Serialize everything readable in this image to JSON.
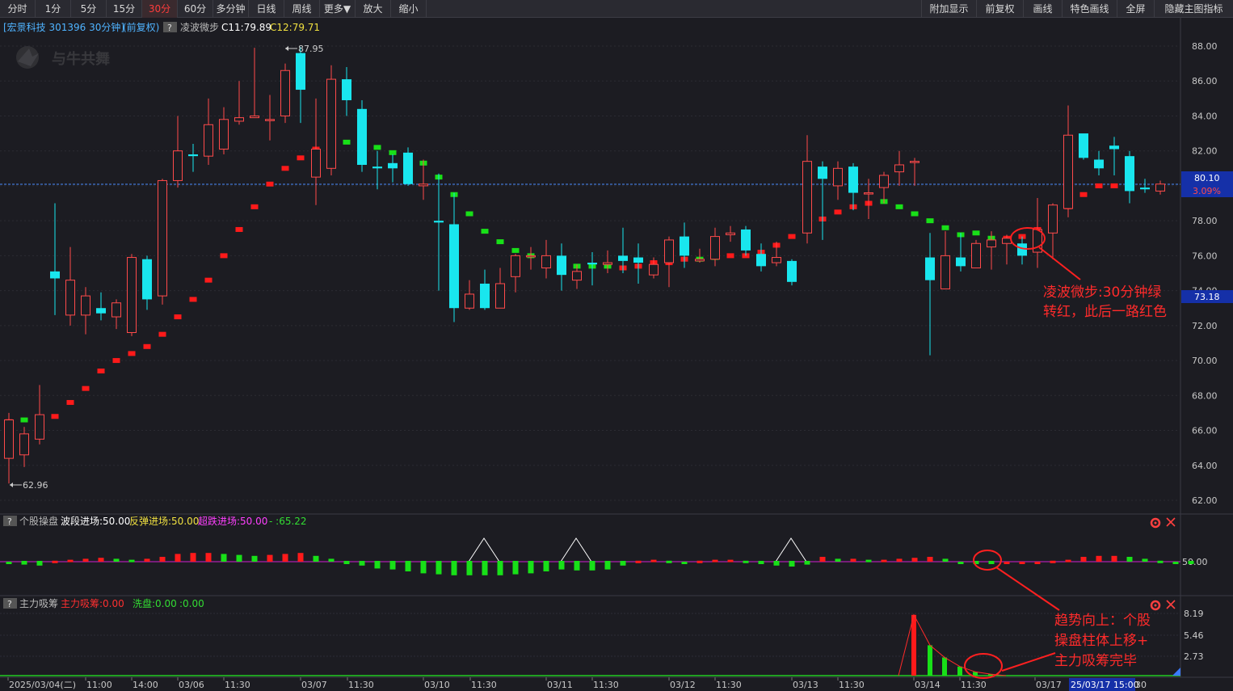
{
  "toolbar": {
    "left": [
      "分时",
      "1分",
      "5分",
      "15分",
      "30分",
      "60分",
      "多分钟",
      "日线",
      "周线",
      "更多▼",
      "放大",
      "缩小"
    ],
    "active": "30分",
    "right": [
      "附加显示",
      "前复权",
      "画线",
      "特色画线",
      "全屏",
      "隐藏主图指标"
    ]
  },
  "main_panel": {
    "stock_label": "[宏景科技 301396 30分钟]",
    "adjust_label": "(前复权)",
    "help_mark": "?",
    "indicator_name": "凌波微步",
    "c1_label": "C11:79.89",
    "c2_label": "C12:79.71",
    "watermark": "与牛共舞",
    "high_marker": "87.95",
    "low_marker": "62.96",
    "current_price_tag": "80.10",
    "current_pct_tag": "3.09%",
    "crosshair_tag": "73.18",
    "price_ticks": [
      "88.00",
      "86.00",
      "84.00",
      "82.00",
      "80.00",
      "78.00",
      "76.00",
      "74.00",
      "72.00",
      "70.00",
      "68.00",
      "66.00",
      "64.00",
      "62.00"
    ],
    "annotation_line1": "凌波微步:30分钟绿",
    "annotation_line2": "转红，此后一路红色"
  },
  "panel2": {
    "help_mark": "?",
    "name": "个股操盘",
    "wave_label": "波段进场:50.00",
    "rebound_label": "反弹进场:50.00",
    "oversold_label": "超跌进场:50.00",
    "extra_label": "-  :65.22",
    "axis_tick": "50.00",
    "annotation_line1": "趋势向上：个股",
    "annotation_line2": "操盘柱体上移+",
    "annotation_line3": "主力吸筹完毕"
  },
  "panel3": {
    "help_mark": "?",
    "name": "主力吸筹",
    "accum_label": "主力吸筹:0.00",
    "wash_label": "洗盘:0.00",
    "extra_label": ":0.00",
    "axis_ticks": [
      "8.19",
      "5.46",
      "2.73"
    ]
  },
  "time_axis": {
    "labels": [
      "2025/03/04(二)",
      "11:00",
      "14:00",
      "03/06",
      "11:30",
      "03/07",
      "11:30",
      "03/10",
      "11:30",
      "03/11",
      "11:30",
      "03/12",
      "11:30",
      "03/13",
      "11:30",
      "03/14",
      "11:30",
      "03/17"
    ],
    "cursor_label": "25/03/17 15:00",
    "cursor_tail": "30"
  },
  "chart_data": {
    "type": "candlestick",
    "interval": "30分钟",
    "y_range": [
      61.4,
      89.0
    ],
    "y_ticks": [
      88,
      86,
      84,
      82,
      80,
      78,
      76,
      74,
      72,
      70,
      68,
      66,
      64,
      62
    ],
    "fields": [
      "open",
      "close",
      "high",
      "low"
    ],
    "candles": [
      [
        64.4,
        66.6,
        67.0,
        62.96
      ],
      [
        64.6,
        65.8,
        66.2,
        63.9
      ],
      [
        65.5,
        66.9,
        68.6,
        65.2
      ],
      [
        75.1,
        74.7,
        79.0,
        72.6
      ],
      [
        72.6,
        74.6,
        76.5,
        72.0
      ],
      [
        72.6,
        73.7,
        74.2,
        71.5
      ],
      [
        73.0,
        72.7,
        73.9,
        72.3
      ],
      [
        72.5,
        73.3,
        73.5,
        71.8
      ],
      [
        71.6,
        75.9,
        76.1,
        71.4
      ],
      [
        75.8,
        73.5,
        76.0,
        72.9
      ],
      [
        73.7,
        80.3,
        80.4,
        73.2
      ],
      [
        80.3,
        82.0,
        84.0,
        79.9
      ],
      [
        81.8,
        81.7,
        82.4,
        80.8
      ],
      [
        81.7,
        83.5,
        85.0,
        81.2
      ],
      [
        82.1,
        83.8,
        84.5,
        81.8
      ],
      [
        83.7,
        83.9,
        86.0,
        83.5
      ],
      [
        83.9,
        84.0,
        87.9,
        84.0
      ],
      [
        83.8,
        83.8,
        85.2,
        82.6
      ],
      [
        84.0,
        86.6,
        87.0,
        83.6
      ],
      [
        87.6,
        85.5,
        87.95,
        83.6
      ],
      [
        80.5,
        82.1,
        85.0,
        78.9
      ],
      [
        81.0,
        86.1,
        86.9,
        80.6
      ],
      [
        86.1,
        84.9,
        86.8,
        84.0
      ],
      [
        84.4,
        81.2,
        84.9,
        80.8
      ],
      [
        81.1,
        81.0,
        82.0,
        79.8
      ],
      [
        81.3,
        81.0,
        81.8,
        80.2
      ],
      [
        81.9,
        80.1,
        82.2,
        80.0
      ],
      [
        80.0,
        80.1,
        81.5,
        79.2
      ],
      [
        78.0,
        77.9,
        80.7,
        74.0
      ],
      [
        77.8,
        73.0,
        79.6,
        72.2
      ],
      [
        73.0,
        73.8,
        74.6,
        72.9
      ],
      [
        74.4,
        73.0,
        75.2,
        72.9
      ],
      [
        73.0,
        74.4,
        75.3,
        73.0
      ],
      [
        74.8,
        76.0,
        76.1,
        73.9
      ],
      [
        76.0,
        76.0,
        76.5,
        75.2
      ],
      [
        75.3,
        76.0,
        76.9,
        74.7
      ],
      [
        76.0,
        74.9,
        76.7,
        74.0
      ],
      [
        74.6,
        75.1,
        75.5,
        74.1
      ],
      [
        75.6,
        75.5,
        76.2,
        74.3
      ],
      [
        75.5,
        75.6,
        76.3,
        75.0
      ],
      [
        76.0,
        75.7,
        77.6,
        75.0
      ],
      [
        75.9,
        75.6,
        76.7,
        74.4
      ],
      [
        74.9,
        75.5,
        75.9,
        74.7
      ],
      [
        75.6,
        76.9,
        77.1,
        74.2
      ],
      [
        77.1,
        76.0,
        77.9,
        75.3
      ],
      [
        75.7,
        75.8,
        76.4,
        75.6
      ],
      [
        75.8,
        77.1,
        77.6,
        75.4
      ],
      [
        77.2,
        77.3,
        77.7,
        76.8
      ],
      [
        77.5,
        76.3,
        77.7,
        76.0
      ],
      [
        76.1,
        75.4,
        76.7,
        75.1
      ],
      [
        75.6,
        75.9,
        76.8,
        75.4
      ],
      [
        75.7,
        74.5,
        75.8,
        74.3
      ],
      [
        77.3,
        81.4,
        82.9,
        76.7
      ],
      [
        81.1,
        80.4,
        81.4,
        76.9
      ],
      [
        80.0,
        81.0,
        81.4,
        79.2
      ],
      [
        81.1,
        79.6,
        81.3,
        78.6
      ],
      [
        79.6,
        79.6,
        80.4,
        78.1
      ],
      [
        79.9,
        80.6,
        80.8,
        79.0
      ],
      [
        80.8,
        81.2,
        82.0,
        80.0
      ],
      [
        81.4,
        81.4,
        81.6,
        80.0
      ],
      [
        75.9,
        74.6,
        77.3,
        70.3
      ],
      [
        74.1,
        76.0,
        77.4,
        74.7
      ],
      [
        75.9,
        75.4,
        77.3,
        75.1
      ],
      [
        75.3,
        76.7,
        76.9,
        75.3
      ],
      [
        76.5,
        76.9,
        77.4,
        75.2
      ],
      [
        76.7,
        77.0,
        77.2,
        75.5
      ],
      [
        76.7,
        76.0,
        77.1,
        75.5
      ],
      [
        76.2,
        77.5,
        79.3,
        75.3
      ],
      [
        77.3,
        78.9,
        79.0,
        75.8
      ],
      [
        78.7,
        82.9,
        84.6,
        78.2
      ],
      [
        83.0,
        81.6,
        82.9,
        81.5
      ],
      [
        81.5,
        81.0,
        82.0,
        80.6
      ],
      [
        82.3,
        82.1,
        82.8,
        80.6
      ],
      [
        81.7,
        79.7,
        82.0,
        79.0
      ],
      [
        79.9,
        79.8,
        80.4,
        79.6
      ],
      [
        79.7,
        80.1,
        80.3,
        79.5
      ]
    ],
    "lingbo_line": [
      [
        66.5,
        "red"
      ],
      [
        66.6,
        "green"
      ],
      [
        66.5,
        "green"
      ],
      [
        66.8,
        "red"
      ],
      [
        67.6,
        "red"
      ],
      [
        68.4,
        "red"
      ],
      [
        69.4,
        "red"
      ],
      [
        70.0,
        "red"
      ],
      [
        70.4,
        "red"
      ],
      [
        70.8,
        "red"
      ],
      [
        71.5,
        "red"
      ],
      [
        72.5,
        "red"
      ],
      [
        73.5,
        "red"
      ],
      [
        74.6,
        "red"
      ],
      [
        76.0,
        "red"
      ],
      [
        77.5,
        "red"
      ],
      [
        78.8,
        "red"
      ],
      [
        80.1,
        "red"
      ],
      [
        81.0,
        "red"
      ],
      [
        81.6,
        "red"
      ],
      [
        82.1,
        "red"
      ],
      [
        82.4,
        "red"
      ],
      [
        82.5,
        "green"
      ],
      [
        82.5,
        "green"
      ],
      [
        82.2,
        "green"
      ],
      [
        81.9,
        "green"
      ],
      [
        81.6,
        "green"
      ],
      [
        81.3,
        "green"
      ],
      [
        80.5,
        "green"
      ],
      [
        79.5,
        "green"
      ],
      [
        78.4,
        "green"
      ],
      [
        77.4,
        "green"
      ],
      [
        76.8,
        "green"
      ],
      [
        76.3,
        "green"
      ],
      [
        76.0,
        "green"
      ],
      [
        75.8,
        "green"
      ],
      [
        75.6,
        "green"
      ],
      [
        75.4,
        "green"
      ],
      [
        75.4,
        "green"
      ],
      [
        75.4,
        "green"
      ],
      [
        75.3,
        "red"
      ],
      [
        75.4,
        "red"
      ],
      [
        75.6,
        "red"
      ],
      [
        75.6,
        "red"
      ],
      [
        75.8,
        "red"
      ],
      [
        75.8,
        "green"
      ],
      [
        75.9,
        "green"
      ],
      [
        76.0,
        "red"
      ],
      [
        76.0,
        "red"
      ],
      [
        76.2,
        "red"
      ],
      [
        76.6,
        "red"
      ],
      [
        77.1,
        "red"
      ],
      [
        77.6,
        "red"
      ],
      [
        78.1,
        "red"
      ],
      [
        78.5,
        "red"
      ],
      [
        78.8,
        "red"
      ],
      [
        79.0,
        "red"
      ],
      [
        79.1,
        "green"
      ],
      [
        78.8,
        "green"
      ],
      [
        78.4,
        "green"
      ],
      [
        78.0,
        "green"
      ],
      [
        77.6,
        "green"
      ],
      [
        77.2,
        "green"
      ],
      [
        77.3,
        "green"
      ],
      [
        77.0,
        "green"
      ],
      [
        77.0,
        "red"
      ],
      [
        77.1,
        "red"
      ],
      [
        77.5,
        "red"
      ],
      [
        78.1,
        "red"
      ],
      [
        78.8,
        "red"
      ],
      [
        79.5,
        "red"
      ],
      [
        80.0,
        "red"
      ],
      [
        80.0,
        "red"
      ]
    ]
  },
  "operation_data": {
    "baseline": 50,
    "bars": [
      50.0,
      49.7,
      49.6,
      50.1,
      50.2,
      50.3,
      50.4,
      50.3,
      50.2,
      50.3,
      50.5,
      50.8,
      50.9,
      50.9,
      50.8,
      50.7,
      50.6,
      50.7,
      50.8,
      50.9,
      50.6,
      50.3,
      49.9,
      49.6,
      49.3,
      49.2,
      49.0,
      48.8,
      48.7,
      48.6,
      48.6,
      48.6,
      48.6,
      48.7,
      48.8,
      49.0,
      49.2,
      49.1,
      49.1,
      49.2,
      49.6,
      50.1,
      50.2,
      50.1,
      50.0,
      50.1,
      50.2,
      50.2,
      50.1,
      49.9,
      49.6,
      49.5,
      49.7,
      50.5,
      50.3,
      50.3,
      50.2,
      50.2,
      50.3,
      50.4,
      50.5,
      50.3,
      50.0,
      49.8,
      49.9,
      50.0,
      50.0,
      50.0,
      50.1,
      50.2,
      50.5,
      50.6,
      50.6,
      50.5,
      50.3,
      50.1,
      50.0,
      49.8
    ]
  },
  "accumulation_data": {
    "max": 8.19,
    "bars": [
      [
        1131,
        8.0
      ],
      [
        1151,
        4.0
      ],
      [
        1169,
        2.4
      ],
      [
        1188,
        1.2
      ],
      [
        1207,
        0.5
      ],
      [
        1226,
        0.2
      ]
    ]
  }
}
